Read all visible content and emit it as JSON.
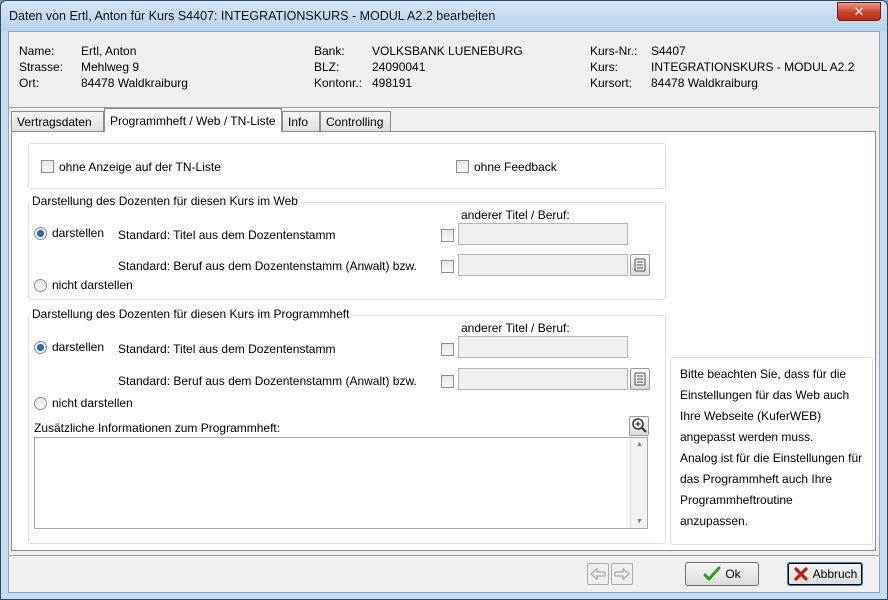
{
  "window": {
    "title": "Daten von Ertl, Anton für Kurs S4407: INTEGRATIONSKURS - MODUL A2.2 bearbeiten",
    "close_glyph": "✕"
  },
  "person": {
    "name_label": "Name:",
    "name": "Ertl, Anton",
    "street_label": "Strasse:",
    "street": "Mehlweg 9",
    "city_label": "Ort:",
    "city": "84478 Waldkraiburg"
  },
  "bank": {
    "bank_label": "Bank:",
    "bank": "VOLKSBANK LUENEBURG",
    "blz_label": "BLZ:",
    "blz": "24090041",
    "account_label": "Kontonr.:",
    "account": "498191"
  },
  "course": {
    "number_label": "Kurs-Nr.:",
    "number": "S4407",
    "course_label": "Kurs:",
    "course": "INTEGRATIONSKURS - MODUL A2.2",
    "location_label": "Kursort:",
    "location": "84478 Waldkraiburg"
  },
  "tabs": [
    {
      "label": "Vertragsdaten",
      "active": false
    },
    {
      "label": "Programmheft / Web / TN-Liste",
      "active": true
    },
    {
      "label": "Info",
      "active": false
    },
    {
      "label": "Controlling",
      "active": false
    }
  ],
  "options": {
    "no_tn_list": "ohne Anzeige auf der TN-Liste",
    "no_feedback": "ohne Feedback"
  },
  "web_group": {
    "title": "Darstellung des Dozenten für diesen Kurs im Web",
    "other_title_label": "anderer Titel / Beruf:",
    "show_label": "darstellen",
    "std_title_label": "Standard: Titel aus dem Dozentenstamm",
    "std_job_label": "Standard: Beruf aus dem Dozentenstamm (Anwalt) bzw.",
    "hide_label": "nicht darstellen",
    "title_value": "",
    "job_value": ""
  },
  "program_group": {
    "title": "Darstellung des Dozenten für diesen Kurs im Programmheft",
    "other_title_label": "anderer Titel / Beruf:",
    "show_label": "darstellen",
    "std_title_label": "Standard: Titel aus dem Dozentenstamm",
    "std_job_label": "Standard: Beruf aus dem Dozentenstamm (Anwalt) bzw.",
    "hide_label": "nicht darstellen",
    "title_value": "",
    "job_value": "",
    "extra_info_label": "Zusätzliche Informationen zum Programmheft:",
    "extra_info_value": ""
  },
  "info_text": {
    "lines": [
      "Bitte beachten Sie, dass für die",
      "Einstellungen für das Web auch",
      "Ihre Webseite (KuferWEB)",
      "angepasst werden muss.",
      "Analog ist für die Einstellungen für",
      "das Programmheft auch Ihre",
      "Programmheftroutine anzupassen."
    ]
  },
  "buttons": {
    "ok": "Ok",
    "cancel": "Abbruch"
  },
  "colors": {
    "ok_check": "#2e9a1e",
    "cancel_x": "#c41a0f",
    "radio_dot": "#1c4f95"
  }
}
